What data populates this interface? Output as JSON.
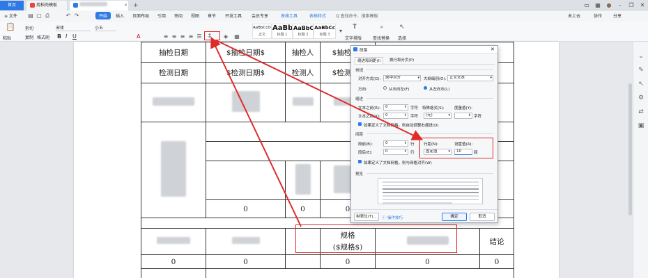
{
  "tabs": {
    "home": "首页",
    "doc1": "找稻壳模板",
    "add": "+"
  },
  "menu": {
    "file": "≡ 文件",
    "items": [
      "开始",
      "插入",
      "页面布局",
      "引用",
      "审阅",
      "视图",
      "章节",
      "开发工具",
      "会员专享",
      "表格工具",
      "表格样式"
    ],
    "search_placeholder": "Q 查找命令、搜索模板",
    "unsaved": "未上云",
    "collab": "协作",
    "share": "分享"
  },
  "ribbon": {
    "cut": "剪切",
    "copy": "复制",
    "paste": "粘贴",
    "format_painter": "格式刷",
    "font_name": "宋体",
    "font_size": "小五",
    "styles": [
      {
        "preview": "AaBbCcDd",
        "name": "正文"
      },
      {
        "preview": "AaBb",
        "name": "标题 1"
      },
      {
        "preview": "AaBbC",
        "name": "标题 2"
      },
      {
        "preview": "AaBbCc",
        "name": "标题 3"
      }
    ],
    "text_tools": "文字排版",
    "find_replace": "查找替换",
    "select": "选择"
  },
  "table": {
    "r1": [
      "抽检日期",
      "$抽检日期$",
      "抽检人",
      "$抽检人$"
    ],
    "r2": [
      "检测日期",
      "$检测日期$",
      "检测人",
      "$检测人$"
    ],
    "zero": "0",
    "spec_line1": "规格",
    "spec_line2": "($规格$)",
    "conclusion": "结论"
  },
  "dialog": {
    "title": "段落",
    "tab1": "缩进和间距(I)",
    "tab2": "换行和分页(P)",
    "general": "常规",
    "align_label": "对齐方式(G):",
    "align_value": "居中对齐",
    "outline_label": "大纲级别(O):",
    "outline_value": "正文文本",
    "direction_label": "方向:",
    "rtl": "从右向左(F)",
    "ltr": "从左向右(L)",
    "indent": "缩进",
    "before_text": "文本之前(R):",
    "before_val": "0",
    "unit_char": "字符",
    "special_label": "特殊格式(S):",
    "measure_label": "度量值(Y):",
    "after_text": "文本之后(X):",
    "after_val": "0",
    "special_value": "(无)",
    "auto_indent": "如果定义了文档网格，则自动调整右缩进(D)",
    "spacing": "间距",
    "before_label": "段前(B):",
    "before_sp": "0",
    "unit_line": "行",
    "after_label": "段后(E):",
    "after_sp": "0",
    "line_spacing_label": "行距(N):",
    "line_spacing_value": "固定值",
    "setting_label": "设置值(A):",
    "setting_value": "10",
    "unit_pt": "磅",
    "snap_grid": "如果定义了文档网格，则与网格对齐(W)",
    "preview": "预览",
    "tabs_btn": "制表位(T)...",
    "tips": "操作技巧",
    "ok": "确定",
    "cancel": "取消"
  },
  "colors": {
    "accent": "#2f7ae5",
    "annotation": "#e02b2b"
  }
}
